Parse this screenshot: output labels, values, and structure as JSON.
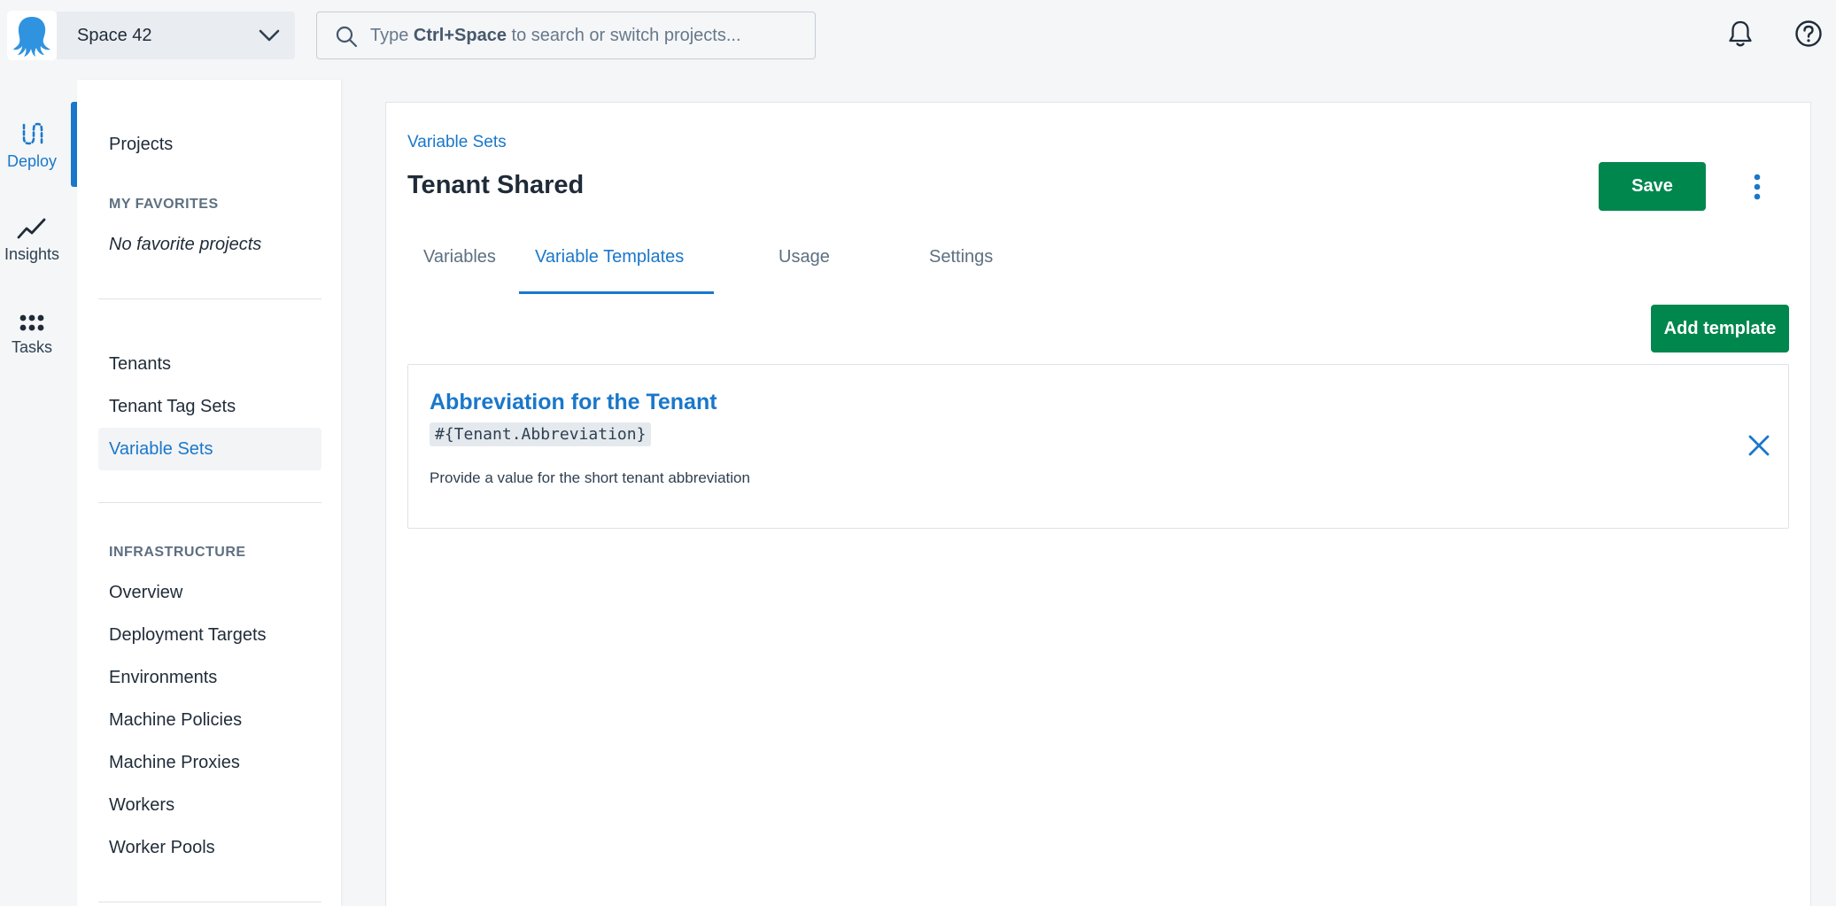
{
  "topbar": {
    "logo_icon": "octopus-logo-icon",
    "space_name": "Space 42",
    "search": {
      "prefix": "Type",
      "shortcut": "Ctrl+Space",
      "suffix": "to search or switch projects..."
    },
    "notifications_icon": "bell-icon",
    "help_icon": "help-circle-icon"
  },
  "rail": {
    "items": [
      {
        "label": "Deploy",
        "icon": "deploy-icon",
        "active": true
      },
      {
        "label": "Insights",
        "icon": "trend-line-icon",
        "active": false
      },
      {
        "label": "Tasks",
        "icon": "grid-dots-icon",
        "active": false
      }
    ]
  },
  "sidebar": {
    "projects": "Projects",
    "favorites_heading": "MY FAVORITES",
    "favorites_empty": "No favorite projects",
    "library_items": [
      "Tenants",
      "Tenant Tag Sets",
      "Variable Sets"
    ],
    "active_item": "Variable Sets",
    "infrastructure_heading": "INFRASTRUCTURE",
    "infrastructure_items": [
      "Overview",
      "Deployment Targets",
      "Environments",
      "Machine Policies",
      "Machine Proxies",
      "Workers",
      "Worker Pools"
    ]
  },
  "main": {
    "breadcrumb": "Variable Sets",
    "title": "Tenant Shared",
    "save_label": "Save",
    "more_icon": "kebab-menu-icon",
    "tabs": [
      {
        "label": "Variables",
        "active": false
      },
      {
        "label": "Variable Templates",
        "active": true
      },
      {
        "label": "Usage",
        "active": false
      },
      {
        "label": "Settings",
        "active": false
      }
    ],
    "add_template_label": "Add template",
    "template": {
      "title": "Abbreviation for the Tenant",
      "variable": "#{Tenant.Abbreviation}",
      "help_text": "Provide a value for the short tenant abbreviation",
      "remove_icon": "close-icon"
    }
  },
  "colors": {
    "accent": "#1a77ca",
    "primary_button": "#00874d",
    "background": "#f4f6f8"
  }
}
